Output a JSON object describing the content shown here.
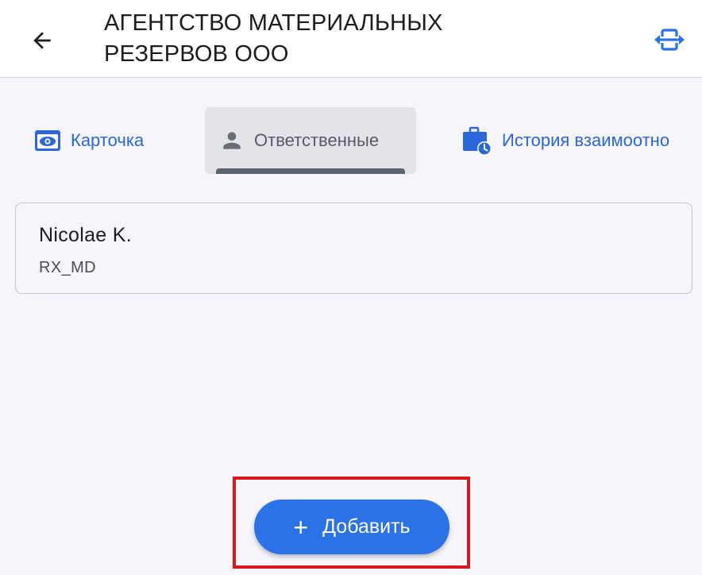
{
  "header": {
    "back_icon": "arrow-left-icon",
    "title": "АГЕНТСТВО МАТЕРИАЛЬНЫХ РЕЗЕРВОВ ООО",
    "expand_icon": "expand-horizontal-icon"
  },
  "tabs": [
    {
      "label": "Карточка",
      "icon": "eye-icon",
      "selected": false
    },
    {
      "label": "Ответственные",
      "icon": "person-icon",
      "selected": true
    },
    {
      "label": "История взаимоотно",
      "icon": "briefcase-clock-icon",
      "selected": false
    }
  ],
  "responsibles": [
    {
      "name": "Nicolae K.",
      "code": "RX_MD"
    }
  ],
  "actions": {
    "add_label": "Добавить",
    "add_icon": "plus-icon"
  },
  "colors": {
    "accent": "#2b72e6",
    "tab_link": "#2b67d9",
    "highlight": "#d9181e",
    "background": "#f6f5fb"
  }
}
